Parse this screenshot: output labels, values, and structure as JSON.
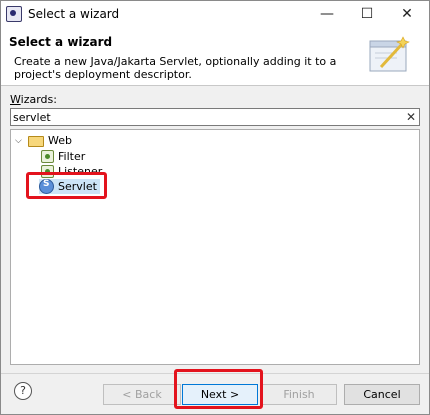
{
  "window": {
    "title": "Select a wizard",
    "minimize": "—",
    "maximize": "☐",
    "close": "✕"
  },
  "header": {
    "title": "Select a wizard",
    "description": "Create a new Java/Jakarta Servlet, optionally adding it to a project's deployment descriptor."
  },
  "filter": {
    "label_mnemonic": "W",
    "label_rest": "izards:",
    "value": "servlet",
    "clear_glyph": "✕"
  },
  "tree": {
    "twisty": "⌵",
    "category": "Web",
    "items": [
      {
        "label": "Filter",
        "icon": "filter-icon"
      },
      {
        "label": "Listener",
        "icon": "listener-icon"
      },
      {
        "label": "Servlet",
        "icon": "servlet-icon",
        "selected": true
      }
    ]
  },
  "footer": {
    "help": "?",
    "back": "< Back",
    "next": "Next >",
    "finish": "Finish",
    "cancel": "Cancel"
  },
  "colors": {
    "highlight": "#e3131d",
    "selection": "#cce4f7",
    "default_button": "#0078d7"
  }
}
